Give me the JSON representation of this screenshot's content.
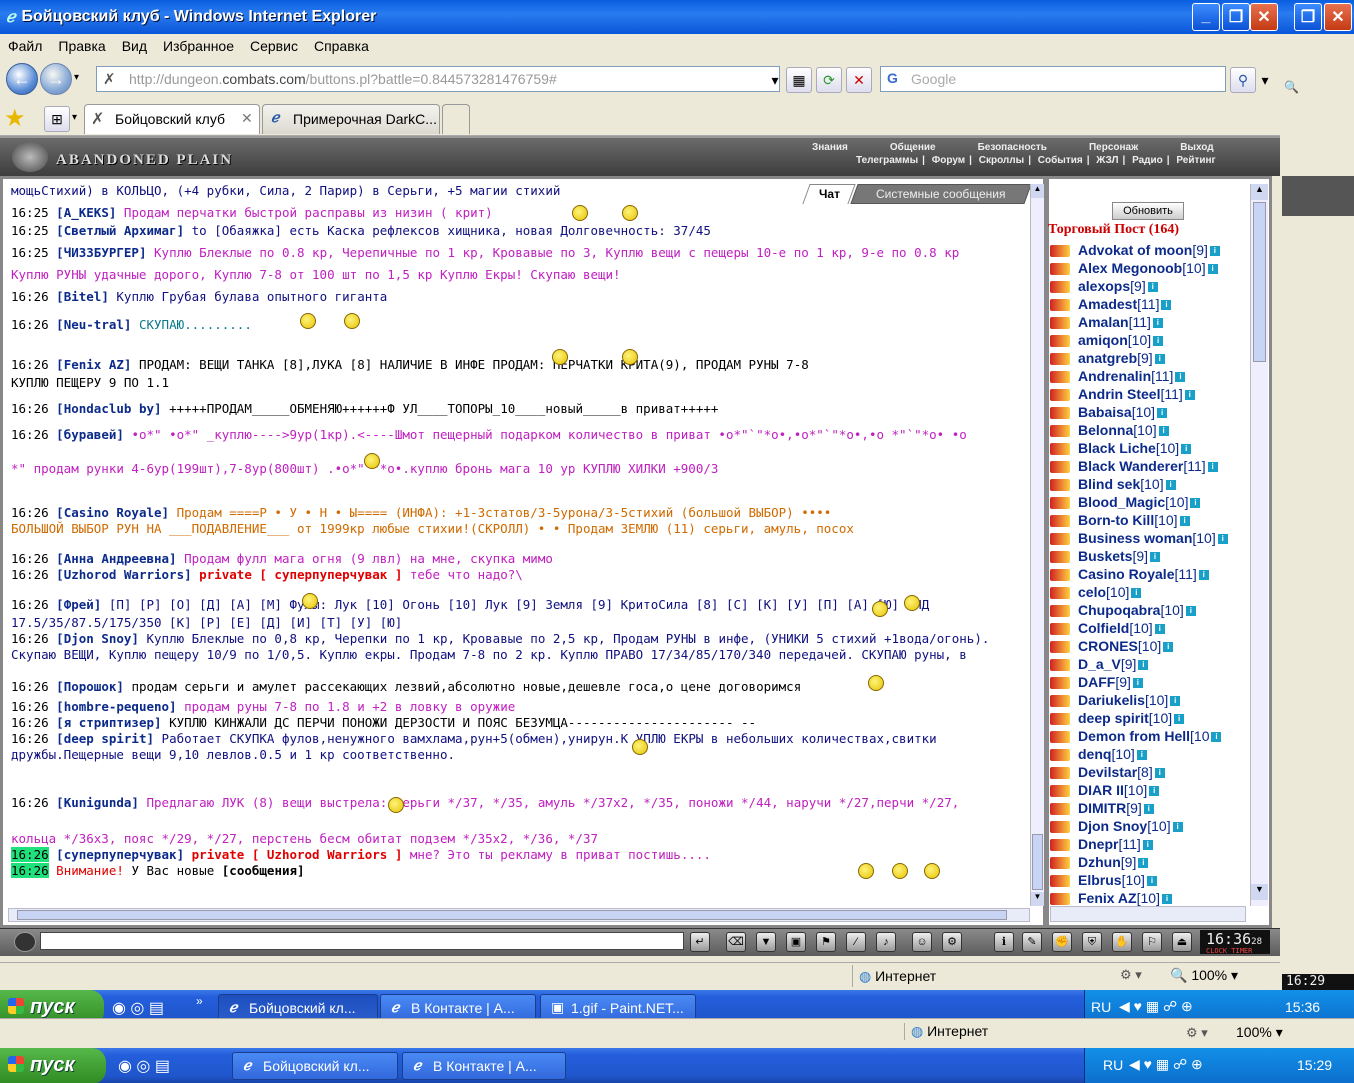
{
  "window": {
    "title": "Бойцовский клуб - Windows Internet Explorer"
  },
  "menu": [
    "Файл",
    "Правка",
    "Вид",
    "Избранное",
    "Сервис",
    "Справка"
  ],
  "address": {
    "prefix": "http://dungeon.",
    "domain": "combats.com",
    "path": "/buttons.pl?battle=0.844573281476759#"
  },
  "search": {
    "placeholder": "Google"
  },
  "tabs": [
    {
      "label": "Бойцовский клуб"
    },
    {
      "label": "Примерочная DarkC..."
    }
  ],
  "game": {
    "logo": "ABANDONED PLAIN",
    "nav_top": [
      "Знания",
      "Общение",
      "Безопасность",
      "Персонаж",
      "Выход"
    ],
    "nav_bottom": [
      "Телеграммы",
      "Форум",
      "Скроллы",
      "События",
      "ЖЗЛ",
      "Радио",
      "Рейтинг"
    ]
  },
  "chat": {
    "tabs": [
      "Чат",
      "Системные сообщения"
    ],
    "lines": [
      {
        "t": "",
        "n": "",
        "m": "мощьСтихий) в КОЛЬЦО, (+4 рубки, Сила, 2 Парир) в Серьги, +5 магии стихий",
        "c": "navy"
      },
      {
        "t": "16:25",
        "n": "[A_KEKS]",
        "m": "Продам перчатки быстрой расправы из низин ( крит)",
        "c": "pink"
      },
      {
        "t": "16:25",
        "n": "[Светлый Архимаг]",
        "m": "to [Обаяжка] есть Каска рефлексов хищника, новая Долговечность: 37/45",
        "c": "navy"
      },
      {
        "t": "16:25",
        "n": "[ЧИЗЗБУРГЕР]",
        "m": "Куплю Блеклые по 0.8 кр, Черепичные по 1 кр, Кровавые по 3, Куплю вещи с пещеры 10-е по 1 кр, 9-е по 0.8 кр",
        "c": "pink"
      },
      {
        "t": "",
        "n": "",
        "m": "Куплю РУНЫ удачные дорого, Куплю 7-8 от 100 шт по 1,5 кр      Куплю Екры! Скупаю вещи!",
        "c": "pink"
      },
      {
        "t": "16:26",
        "n": "[Bitel]",
        "m": "Куплю Грубая булава опытного гиганта",
        "c": "navy"
      },
      {
        "t": "16:26",
        "n": "[Neu-tral]",
        "m": "СКУПАЮ.........",
        "c": "teal"
      },
      {
        "t": "16:26",
        "n": "[Fenix AZ]",
        "m": "ПРОДАМ: ВЕЩИ ТАНКА [8],ЛУКА [8] НАЛИЧИЕ В ИНФЕ                  ПРОДАМ: ПЕРЧАТКИ КРИТА(9), ПРОДАМ РУНЫ 7-8",
        "c": "blk"
      },
      {
        "t": "",
        "n": "",
        "m": "КУПЛЮ ПЕЩЕРУ 9 ПО 1.1",
        "c": "blk"
      },
      {
        "t": "16:26",
        "n": "[Hondaclub by]",
        "m": "+++++ПРОДАМ_____ОБМЕНЯЮ++++++Ф УЛ____ТОПОРЫ_10____новый_____в приват+++++",
        "c": "blk"
      },
      {
        "t": "16:26",
        "n": "[буравей]",
        "m": "•о*\"   •о*\" _куплю---->9ур(1кр).<----Шмот пещерный подарком количество в приват      •о*\"`\"*о•,•о*\"`\"*о•,•о *\"`\"*о• •о",
        "c": "pink"
      },
      {
        "t": "",
        "n": "",
        "m": "*\" продам рунки 4-6ур(199шт),7-8ур(800шт)                .•о*\"`\"*о•.куплю бронь мага 10 ур КУПЛЮ ХИЛКИ +900/3",
        "c": "pink"
      },
      {
        "t": "16:26",
        "n": "[Casino Royale]",
        "m": "Продам ====Р • У • Н • Ы==== (ИНФА): +1-3статов/3-5урона/3-5стихий (большой ВЫБОР) ••••",
        "c": "orange"
      },
      {
        "t": "",
        "n": "",
        "m": "БОЛЬШОЙ ВЫБОР РУН НА ___ПОДАВЛЕНИЕ___ от 1999кр любые стихии!(СКРОЛЛ) • • Продам ЗЕМЛЮ (11) серьги, амуль, посох",
        "c": "orange"
      },
      {
        "t": "16:26",
        "n": "[Анна Андреевна]",
        "m": "Продам фулл мага огня (9 лвл) на мне, скупка мимо",
        "c": "pink"
      },
      {
        "t": "16:26",
        "n": "[Uzhorod Warriors]",
        "p": "private [ суперпуперчувак ]",
        "m": "тебе что надо?\\",
        "c": "pink"
      },
      {
        "t": "16:26",
        "n": "[Фрей]",
        "m": "[П] [Р] [О] [Д] [А] [М]    Фулы: Лук [10] Огонь [10] Лук [9] Земля [9] КритоСила [8] [С] [К] [У] [П] [А] [Ю]      ПНД",
        "c": "navy"
      },
      {
        "t": "",
        "n": "",
        "m": "17.5/35/87.5/175/350 [К] [Р] [Е] [Д] [И] [Т] [У] [Ю]",
        "c": "navy"
      },
      {
        "t": "16:26",
        "n": "[Djon Snoy]",
        "m": "Куплю Блеклые по 0,8 кр, Черепки по 1 кр, Кровавые по 2,5 кр, Продам РУНЫ в инфе, (УНИКИ 5 стихий +1вода/огонь).",
        "c": "navy"
      },
      {
        "t": "",
        "n": "",
        "m": "Скупаю ВЕЩИ, Куплю пещеру 10/9 по 1/0,5. Куплю екры. Продам 7-8 по 2 кр. Куплю ПРАВО 17/34/85/170/340 передачей. СКУПАЮ руны, в",
        "c": "navy"
      },
      {
        "t": "16:26",
        "n": "[Порошок]",
        "m": "продам серьги и амулет рассекающих лезвий,абсолютно новые,дешевле госа,о цене договоримся",
        "c": "blk"
      },
      {
        "t": "16:26",
        "n": "[hombre-pequeno]",
        "m": "продам руны 7-8 по 1.8 и +2 в ловку в оружие",
        "c": "pink"
      },
      {
        "t": "16:26",
        "n": "[я стриптизер]",
        "m": "КУПЛЮ КИНЖАЛИ ДС ПЕРЧИ ПОНОЖИ ДЕРЗОСТИ И ПОЯС БЕЗУМЦА---------------------- --",
        "c": "blk"
      },
      {
        "t": "16:26",
        "n": "[deep spirit]",
        "m": "Работает СКУПКА фулов,ненужного вамхлама,рун+5(обмен),унирун.К УПЛЮ ЕКРЫ в небольших количествах,свитки",
        "c": "navy"
      },
      {
        "t": "",
        "n": "",
        "m": "дружбы.Пещерные вещи 9,10 левлов.0.5 и 1 кр соответственно.",
        "c": "navy"
      },
      {
        "t": "16:26",
        "n": "[Kunigunda]",
        "m": "Предлагаю ЛУК (8) вещи выстрела: серьги */37, */35, амуль */37x2, */35, поножи */44, наручи */27,перчи */27,",
        "c": "pink"
      },
      {
        "t": "",
        "n": "",
        "m": "кольца */36x3, пояс */29, */27, перстень бесм обитат подзем */35x2, */36, */37",
        "c": "pink"
      },
      {
        "t": "16:26",
        "n": "[суперпуперчувак]",
        "p": "private [ Uzhorod Warriors ]",
        "m": "мне? Это ты рекламу в приват постишь....",
        "c": "pink",
        "h": true
      },
      {
        "t": "16:26",
        "n": "",
        "w": "Внимание!",
        "m": "У Вас новые",
        "s": "[сообщения]",
        "c": "blk",
        "h": true
      }
    ]
  },
  "panel": {
    "refresh": "Обновить",
    "title": "Торговый Пост (164)",
    "users": [
      {
        "n": "Advokat of moon",
        "l": "[9]"
      },
      {
        "n": "Alex Megonoob",
        "l": "[10]"
      },
      {
        "n": "alexops",
        "l": "[9]"
      },
      {
        "n": "Amadest",
        "l": "[11]"
      },
      {
        "n": "Amalan",
        "l": "[11]"
      },
      {
        "n": "amiqon",
        "l": "[10]"
      },
      {
        "n": "anatgreb",
        "l": "[9]"
      },
      {
        "n": "Andrenalin",
        "l": "[11]"
      },
      {
        "n": "Andrin Steel",
        "l": "[11]"
      },
      {
        "n": "Babaisa",
        "l": "[10]"
      },
      {
        "n": "Belonna",
        "l": "[10]"
      },
      {
        "n": "Black Liche",
        "l": "[10]"
      },
      {
        "n": "Black Wanderer",
        "l": "[11]"
      },
      {
        "n": "Blind sek",
        "l": "[10]"
      },
      {
        "n": "Blood_Magic",
        "l": "[10]"
      },
      {
        "n": "Born-to Kill",
        "l": "[10]"
      },
      {
        "n": "Business woman",
        "l": "[10]"
      },
      {
        "n": "Buskets",
        "l": "[9]"
      },
      {
        "n": "Casino Royale",
        "l": "[11]"
      },
      {
        "n": "celo",
        "l": "[10]"
      },
      {
        "n": "Chupoqabra",
        "l": "[10]"
      },
      {
        "n": "Colfield",
        "l": "[10]"
      },
      {
        "n": "CRONES",
        "l": "[10]"
      },
      {
        "n": "D_a_V",
        "l": "[9]"
      },
      {
        "n": "DAFF",
        "l": "[9]"
      },
      {
        "n": "Dariukelis",
        "l": "[10]"
      },
      {
        "n": "deep spirit",
        "l": "[10]"
      },
      {
        "n": "Demon from Hell",
        "l": "[10"
      },
      {
        "n": "denq",
        "l": "[10]"
      },
      {
        "n": "Devilstar",
        "l": "[8]"
      },
      {
        "n": "DIAR II",
        "l": "[10]"
      },
      {
        "n": "DIMITR",
        "l": "[9]"
      },
      {
        "n": "Djon Snoy",
        "l": "[10]"
      },
      {
        "n": "Dnepr",
        "l": "[11]"
      },
      {
        "n": "Dzhun",
        "l": "[9]"
      },
      {
        "n": "Elbrus",
        "l": "[10]"
      },
      {
        "n": "Fenix AZ",
        "l": "[10]"
      }
    ]
  },
  "clock": {
    "time": "16:36",
    "sec": "28",
    "label": "CLOCK TIMER"
  },
  "status": {
    "zone": "Интернет",
    "zoom": "100%"
  },
  "taskbar": {
    "start": "пуск",
    "items": [
      "Бойцовский кл...",
      "В Контакте | А...",
      "1.gif - Paint.NET..."
    ],
    "lang": "RU",
    "time": "15:36"
  },
  "bg_window": {
    "status_zone": "Интернет",
    "zoom": "100%",
    "taskbar_items": [
      "Бойцовский кл...",
      "В Контакте | А..."
    ],
    "time": "15:29",
    "clock": "16:29"
  }
}
